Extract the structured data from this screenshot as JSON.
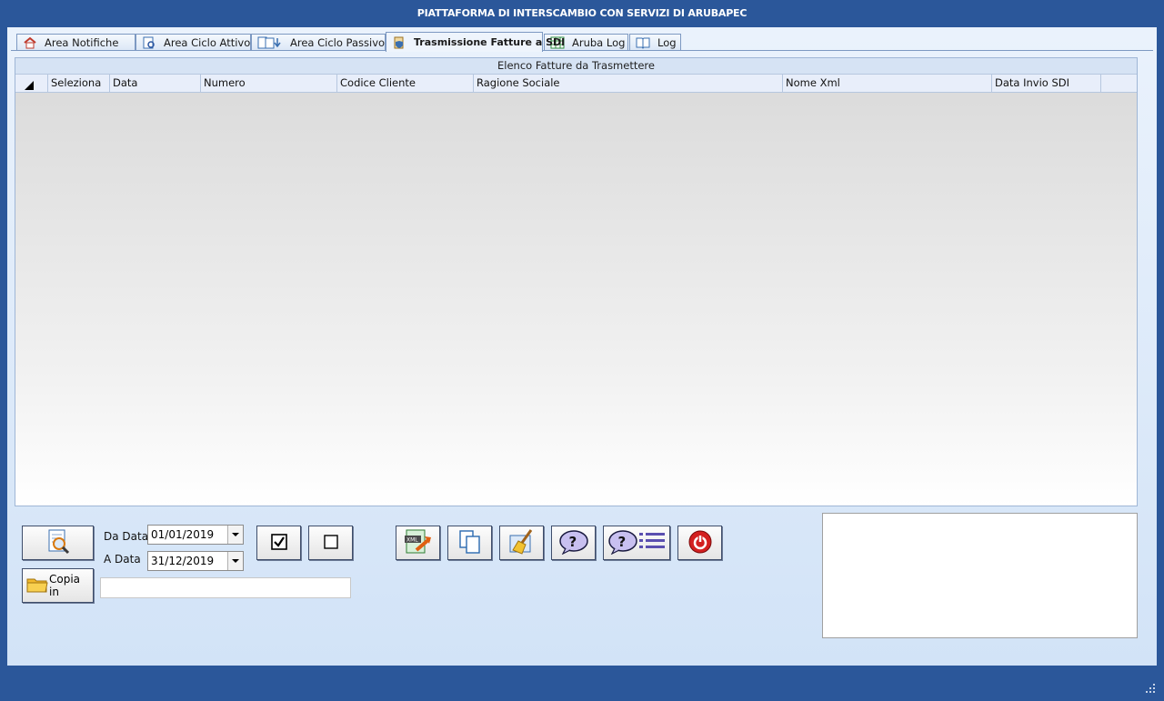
{
  "window": {
    "title": "PIATTAFORMA DI INTERSCAMBIO CON SERVIZI DI ARUBAPEC"
  },
  "tabs": [
    {
      "label": "Area Notifiche",
      "icon": "house-icon"
    },
    {
      "label": "Area Ciclo Attivo",
      "icon": "document-search-icon"
    },
    {
      "label": "Area Ciclo Passivo",
      "icon": "document-download-icon"
    },
    {
      "label": "Trasmissione Fatture a SDI",
      "icon": "shield-document-icon",
      "active": true
    },
    {
      "label": "Aruba Log",
      "icon": "spreadsheet-icon"
    },
    {
      "label": "Log",
      "icon": "book-icon"
    }
  ],
  "grid": {
    "caption": "Elenco Fatture da Trasmettere",
    "columns": [
      "Seleziona",
      "Data",
      "Numero",
      "Codice Cliente",
      "Ragione Sociale",
      "Nome Xml",
      "Data Invio SDI"
    ]
  },
  "filters": {
    "from_label": "Da Data",
    "from_value": "01/01/2019",
    "to_label": "A Data",
    "to_value": "31/12/2019"
  },
  "actions": {
    "copy_label": "Copia in",
    "copy_path": ""
  },
  "colors": {
    "chrome": "#2b579a",
    "accent_red": "#d32020"
  }
}
